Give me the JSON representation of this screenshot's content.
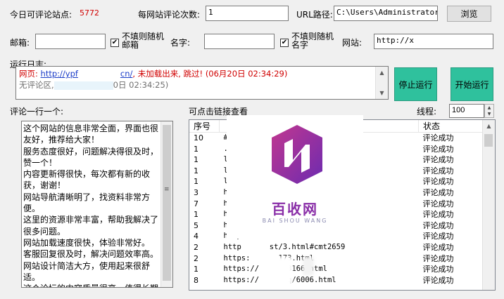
{
  "top": {
    "sites_label": "今日可评论站点:",
    "sites_count": "5772",
    "per_site_label": "每网站评论次数:",
    "per_site_value": "1",
    "url_path_label": "URL路径:",
    "url_path_value": "C:\\Users\\Administrator.W",
    "browse_button": "浏览"
  },
  "row2": {
    "email_label": "邮箱:",
    "email_value": "",
    "email_random_label": "不填则随机邮箱",
    "name_label": "名字:",
    "name_value": "",
    "name_random_label": "不填则随机名字",
    "site_label": "网站:",
    "site_value": "http://x"
  },
  "log": {
    "label": "运行日志:",
    "line1_prefix": "网页:",
    "line1_url": "http://ypf",
    "line1_url_tail": "cn/",
    "line1_msg": ", 未加载出来, 跳过!",
    "line1_time": "(06月20日 02:34:29)",
    "line2_prefix": "无评论区,",
    "line2_time": "0日 02:34:25)"
  },
  "buttons": {
    "stop": "停止运行",
    "start": "开始运行"
  },
  "comments": {
    "label": "评论一行一个:",
    "lines": [
      "这个网站的信息非常全面，界面也很",
      "友好，推荐给大家！",
      "服务态度很好，问题解决得很及时，",
      "赞一个！",
      "内容更新得很快，每次都有新的收",
      "获，谢谢！",
      "网站导航清晰明了，找资料非常方",
      "便。",
      "这里的资源非常丰富，帮助我解决了",
      "很多问题。",
      "网站加载速度很快，体验非常好。",
      "客服回复很及时，解决问题效率高。",
      "网站设计简洁大方，使用起来很舒",
      "适。",
      "这个论坛的内容质量很高，值得长期"
    ]
  },
  "links": {
    "label": "可点击链接查看",
    "threads_label": "线程:",
    "threads_value": "100",
    "columns": [
      "序号",
      "",
      "状态"
    ],
    "rows": [
      {
        "num": "10",
        "url": "#cmt2117",
        "status": "评论成功"
      },
      {
        "num": "1",
        "url": ".html",
        "status": "评论成功"
      },
      {
        "num": "1",
        "url": "l",
        "status": "评论成功"
      },
      {
        "num": "1",
        "url": "l",
        "status": "评论成功"
      },
      {
        "num": "1",
        "url": "l",
        "status": "评论成功"
      },
      {
        "num": "3",
        "url": "h",
        "status": "评论成功"
      },
      {
        "num": "7",
        "url": "ht",
        "status": "评论成功"
      },
      {
        "num": "1",
        "url": "ht",
        "status": "评论成功"
      },
      {
        "num": "5",
        "url": "ht",
        "status": "评论成功"
      },
      {
        "num": "4",
        "url": "http",
        "status": "评论成功"
      },
      {
        "num": "2",
        "url": "http",
        "status": "评论成功"
      },
      {
        "num": "2",
        "url": "https:",
        "status": "评论成功"
      },
      {
        "num": "1",
        "url": "https://",
        "status": "评论成功"
      },
      {
        "num": "8",
        "url": "https://",
        "status": "评论成功"
      }
    ],
    "url_tails": [
      "",
      "",
      "",
      "",
      "",
      "",
      "",
      "",
      "",
      ".html",
      "st/3.html#cmt2659",
      "173.html",
      "3166.html",
      "q/6006.html"
    ]
  },
  "watermark": {
    "title": "百收网",
    "subtitle": "BAI SHOU WANG"
  },
  "colors": {
    "accent_green": "#2fc19d",
    "error_red": "#d00000",
    "link_blue": "#1a3cc8"
  }
}
